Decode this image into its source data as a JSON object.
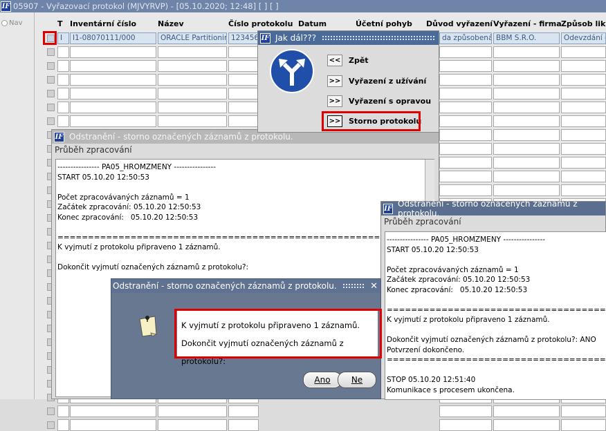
{
  "window": {
    "title": "05907 - Vyřazovací protokol (MJVYRVP) - [05.10.2020; 12:48]  [ ]  [ ]"
  },
  "nav": {
    "label": "Nav"
  },
  "table": {
    "headers": [
      "T",
      "Inventární číslo",
      "Název",
      "Číslo protokolu",
      "Datum",
      "Účetní pohyb",
      "Důvod vyřazení",
      "Vyřazení - firma",
      "Způsob likv"
    ],
    "row1": {
      "t": "I",
      "inv": "I1-08070111/000",
      "nazev": "ORACLE Partitionin",
      "cislo": "123456",
      "duvod": "da způsobená",
      "firma": "BBM S.R.O.",
      "zpusob": "Odevzdání d"
    }
  },
  "jakdal": {
    "title": "Jak dál???",
    "items": [
      {
        "arrow": "<<",
        "label": "Zpět"
      },
      {
        "arrow": ">>",
        "label": "Vyřazení z užívání"
      },
      {
        "arrow": ">>",
        "label": "Vyřazení s opravou"
      },
      {
        "arrow": ">>",
        "label": "Storno protokolu"
      }
    ]
  },
  "log1": {
    "title": "Odstranění - storno označených záznamů z protokolu.",
    "subtitle": "Průběh zpracování",
    "text": "---------------- PA05_HROMZMENY ----------------\nSTART 05.10.20 12:50:53\n\nPočet zpracovávaných záznamů = 1\nZačátek zpracování: 05.10.20 12:50:53\nKonec zpracování:   05.10.20 12:50:53\n\n=================================================================\nK vyjmutí z protokolu připraveno 1 záznamů.\n\nDokončit vyjmutí označených záznamů z protokolu?:"
  },
  "log2": {
    "title": "Odstranění - storno označených záznamů z protokolu.",
    "subtitle": "Průběh zpracování",
    "text": "---------------- PA05_HROMZMENY ----------------\nSTART 05.10.20 12:50:53\n\nPočet zpracovávaných záznamů = 1\nZačátek zpracování: 05.10.20 12:50:53\nKonec zpracování:   05.10.20 12:50:53\n\n=================================================================\nK vyjmutí z protokolu připraveno 1 záznamů.\n\nDokončit vyjmutí označených záznamů z protokolu?: ANO\nPotvrzení dokončeno.\n=================================================================\n\nSTOP 05.10.20 12:51:40\nKomunikace s procesem ukončena."
  },
  "confirm": {
    "title": "Odstranění - storno označených záznamů z protokolu.",
    "close": "✕",
    "message1": "K vyjmutí z protokolu připraveno 1 záznamů.",
    "message2": "Dokončit vyjmutí označených záznamů z protokolu?:",
    "yes": "Ano",
    "no": "Ne"
  },
  "colors": {
    "highlight": "#e00000",
    "titlebar": "#6e84a8",
    "active_title": "#4a6a9a"
  }
}
